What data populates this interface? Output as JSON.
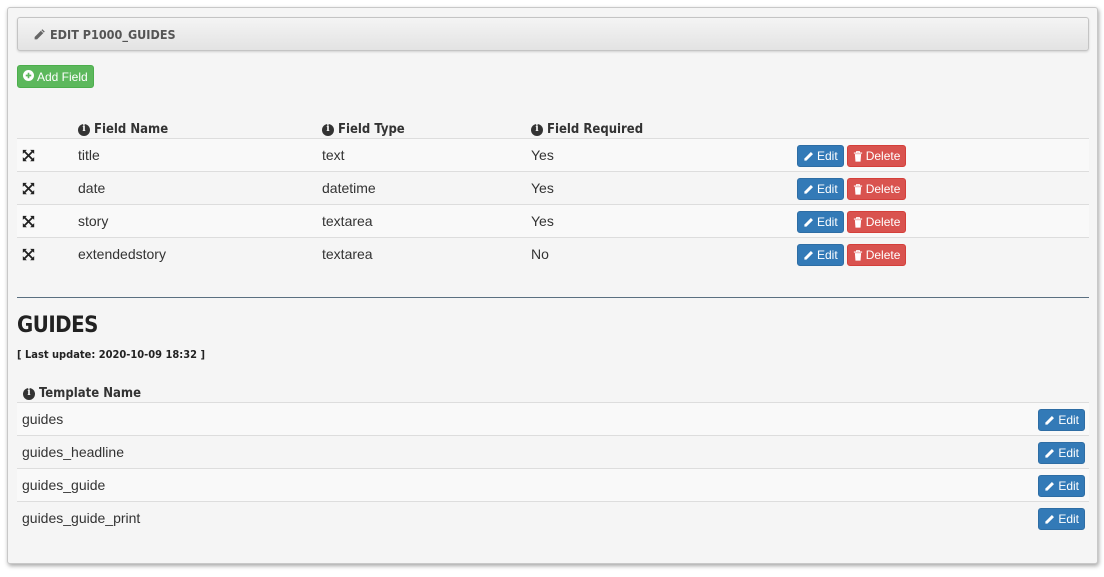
{
  "panel": {
    "title": "EDIT P1000_GUIDES"
  },
  "toolbar": {
    "add_field_label": "Add Field"
  },
  "fields_table": {
    "headers": {
      "field_name": "Field Name",
      "field_type": "Field Type",
      "field_required": "Field Required"
    },
    "rows": [
      {
        "name": "title",
        "type": "text",
        "required": "Yes"
      },
      {
        "name": "date",
        "type": "datetime",
        "required": "Yes"
      },
      {
        "name": "story",
        "type": "textarea",
        "required": "Yes"
      },
      {
        "name": "extendedstory",
        "type": "textarea",
        "required": "No"
      }
    ],
    "edit_label": "Edit",
    "delete_label": "Delete"
  },
  "templates_section": {
    "title": "GUIDES",
    "last_update": "[ Last update: 2020-10-09 18:32 ]",
    "header": "Template Name",
    "rows": [
      {
        "name": "guides"
      },
      {
        "name": "guides_headline"
      },
      {
        "name": "guides_guide"
      },
      {
        "name": "guides_guide_print"
      }
    ],
    "edit_label": "Edit"
  },
  "colors": {
    "success": "#5cb85c",
    "primary": "#337ab7",
    "danger": "#d9534f",
    "panel_bg": "#f5f5f5"
  },
  "icons": {
    "header": "pencil-icon",
    "add": "plus-circle-icon",
    "info": "info-icon",
    "move": "move-arrows-icon",
    "edit": "pencil-icon",
    "delete": "trash-icon"
  }
}
